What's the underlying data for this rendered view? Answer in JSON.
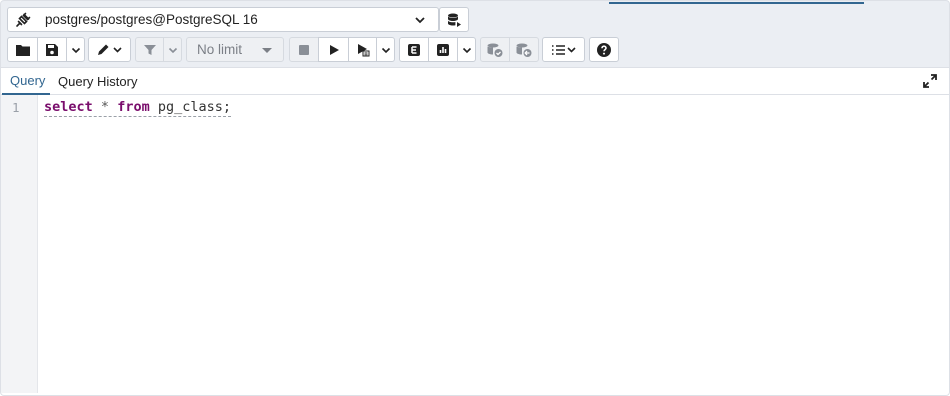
{
  "connection": {
    "label": "postgres/postgres@PostgreSQL 16",
    "icon": "connection-plug-icon"
  },
  "toolbar": {
    "limit_label": "No limit",
    "buttons": [
      "open-file-icon",
      "save-icon",
      "edit-pencil-icon",
      "filter-icon",
      "stop-icon",
      "execute-icon",
      "execute-script-icon",
      "explain-icon",
      "explain-analyze-icon",
      "commit-icon",
      "rollback-icon",
      "macros-icon",
      "help-icon"
    ]
  },
  "tabs": {
    "query": "Query",
    "history": "Query History",
    "active": "Query"
  },
  "editor": {
    "line_number": "1",
    "kw_select": "select",
    "star": "*",
    "kw_from": "from",
    "table": "pg_class;"
  },
  "colors": {
    "accent": "#326690",
    "keyword": "#7a0e6c",
    "toolbar_bg": "#ebeef3"
  }
}
